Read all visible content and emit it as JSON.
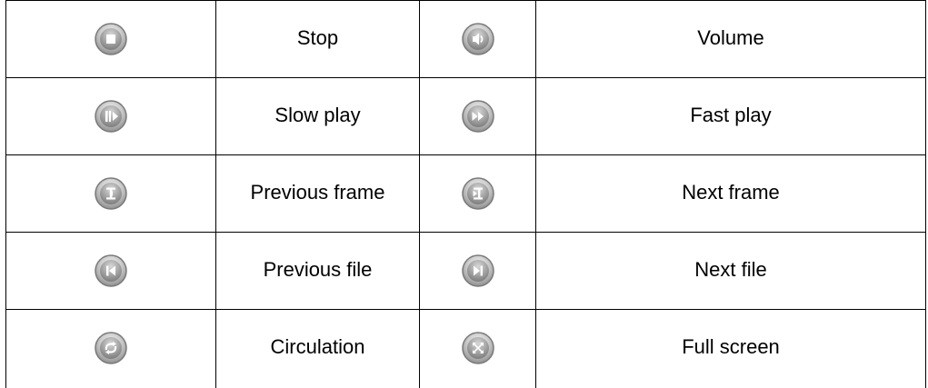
{
  "rows": [
    {
      "left": {
        "icon": "stop-icon",
        "label": "Stop"
      },
      "right": {
        "icon": "volume-icon",
        "label": "Volume"
      }
    },
    {
      "left": {
        "icon": "slow-play-icon",
        "label": "Slow play"
      },
      "right": {
        "icon": "fast-play-icon",
        "label": "Fast play"
      }
    },
    {
      "left": {
        "icon": "previous-frame-icon",
        "label": "Previous frame"
      },
      "right": {
        "icon": "next-frame-icon",
        "label": "Next frame"
      }
    },
    {
      "left": {
        "icon": "previous-file-icon",
        "label": "Previous file"
      },
      "right": {
        "icon": "next-file-icon",
        "label": "Next file"
      }
    },
    {
      "left": {
        "icon": "circulation-icon",
        "label": "Circulation"
      },
      "right": {
        "icon": "full-screen-icon",
        "label": "Full screen"
      }
    }
  ],
  "colors": {
    "border": "#000000",
    "icon_ring": "#8c8c8c",
    "icon_fill_light": "#f2f2f2",
    "icon_fill_dark": "#9a9a9a",
    "icon_glyph": "#ffffff"
  }
}
